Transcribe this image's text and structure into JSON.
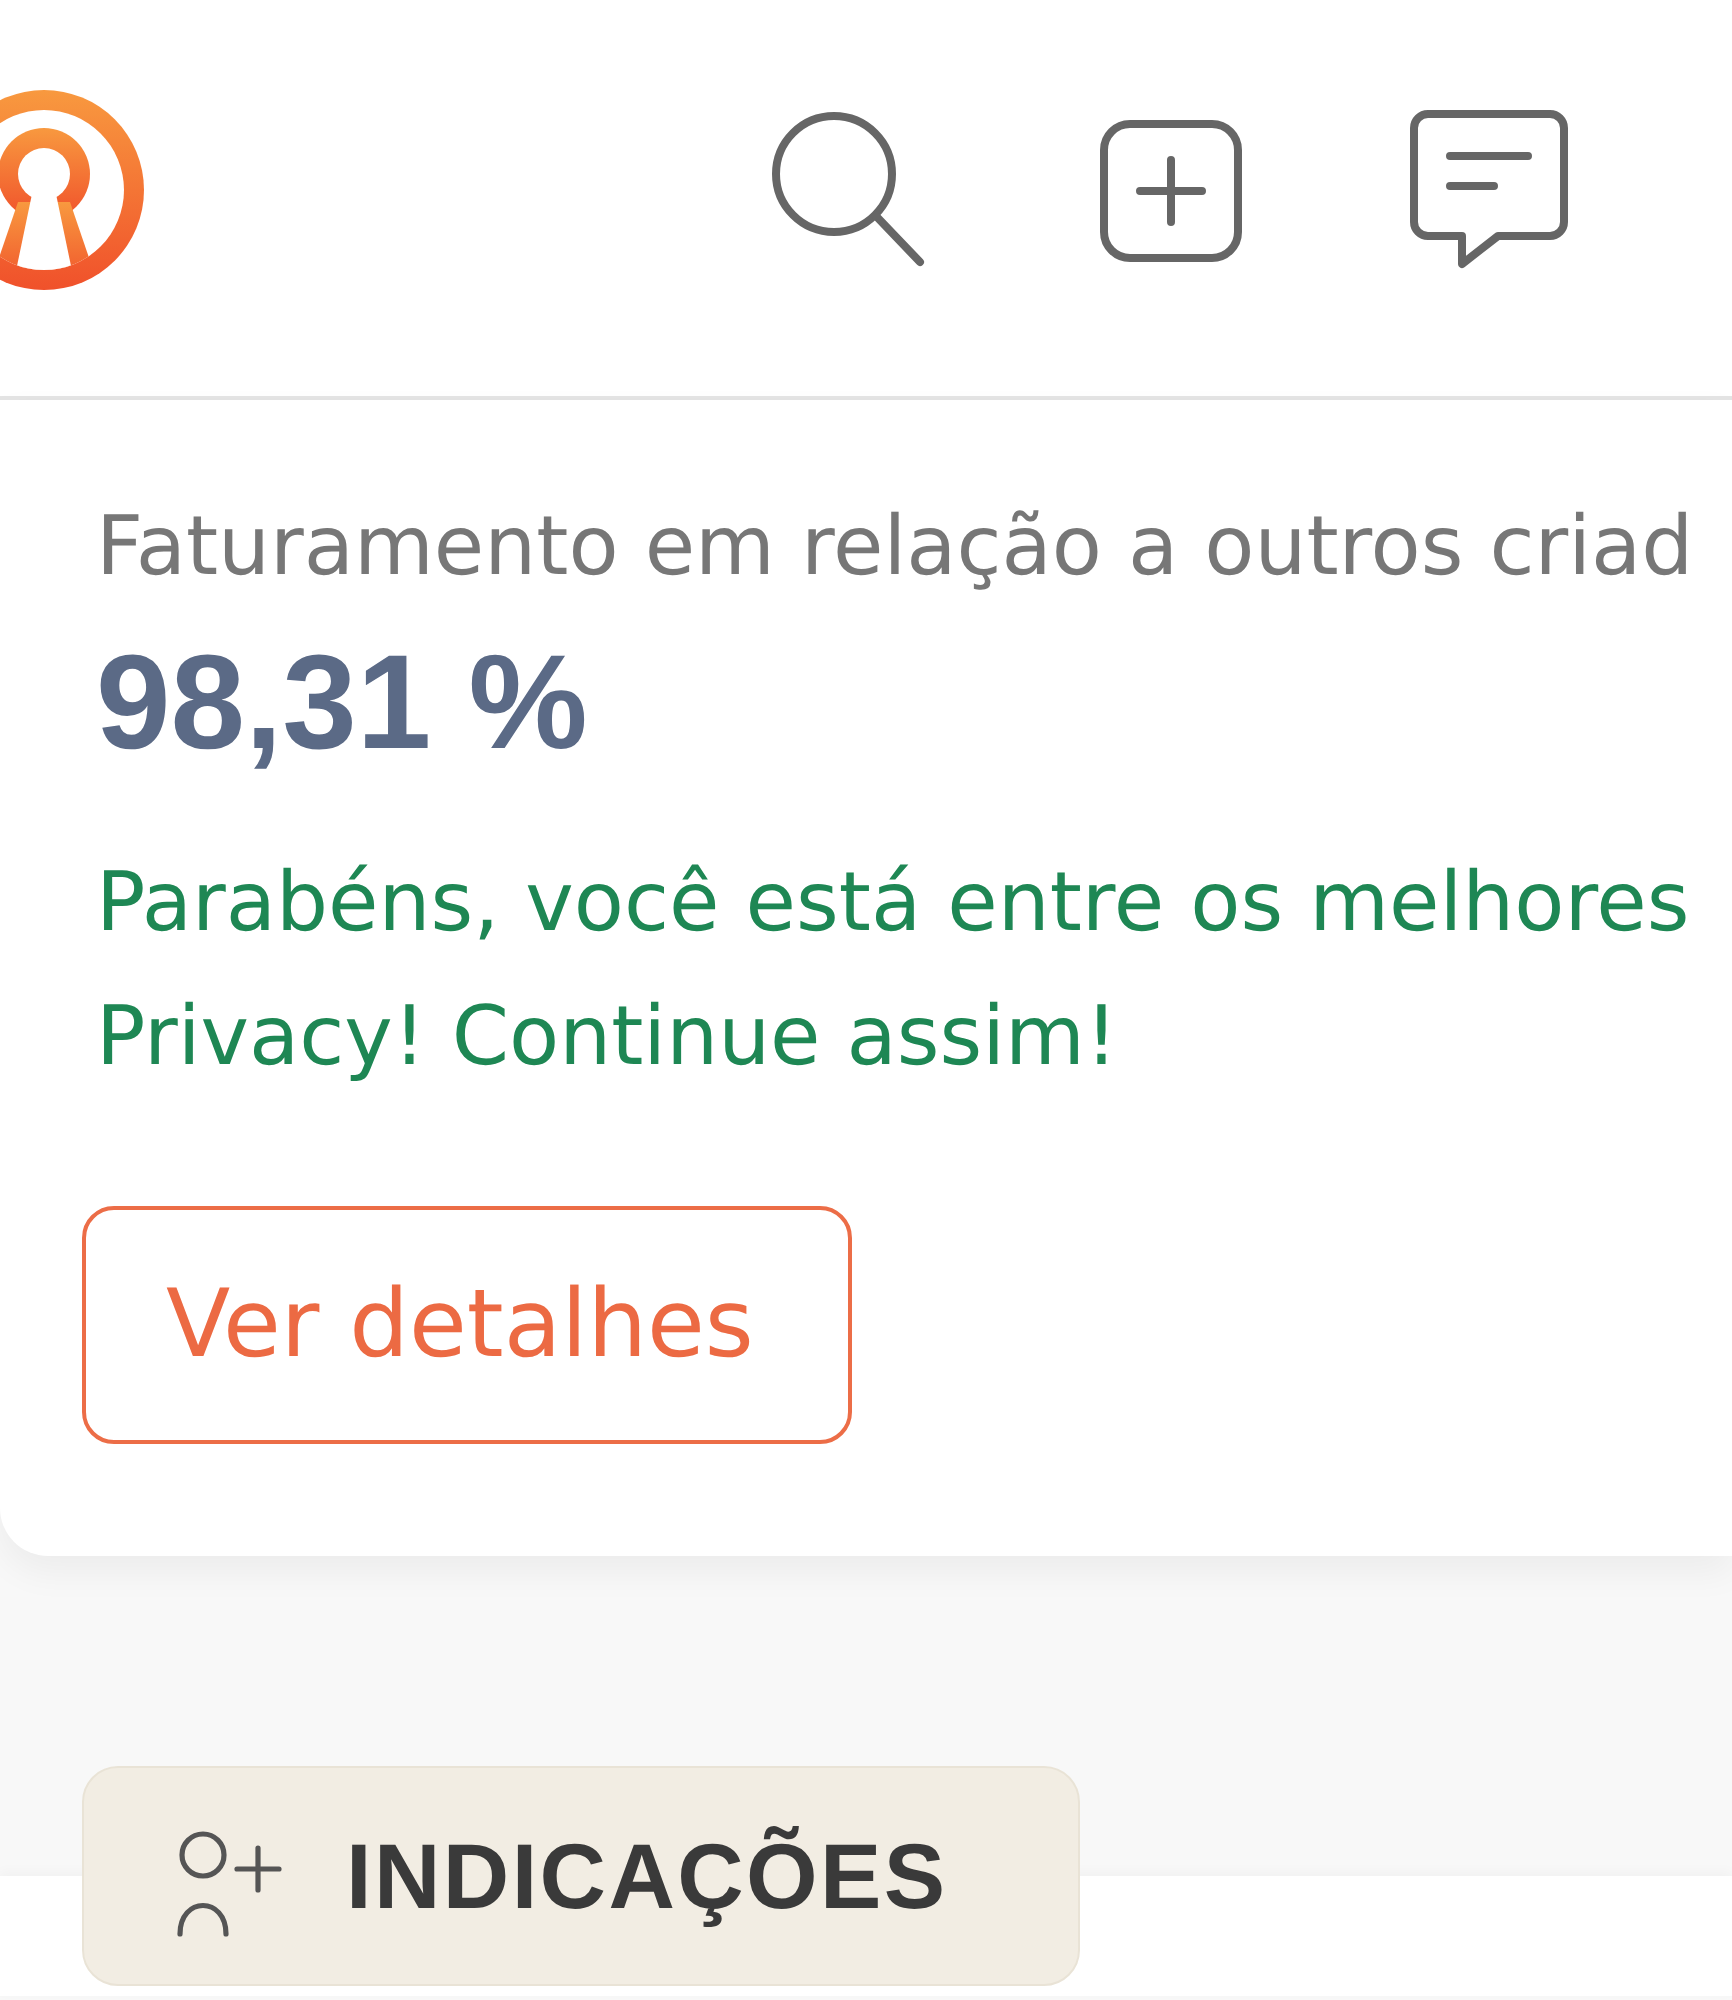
{
  "stat_card": {
    "label": "Faturamento em relação a outros criad",
    "value": "98,31 %",
    "message_lines": [
      "Parabéns, você está entre os melhores",
      "Privacy! Continue assim!"
    ],
    "button_label": "Ver detalhes"
  },
  "tabs": [
    {
      "label": "INDICAÇÕES",
      "selected": true
    }
  ]
}
